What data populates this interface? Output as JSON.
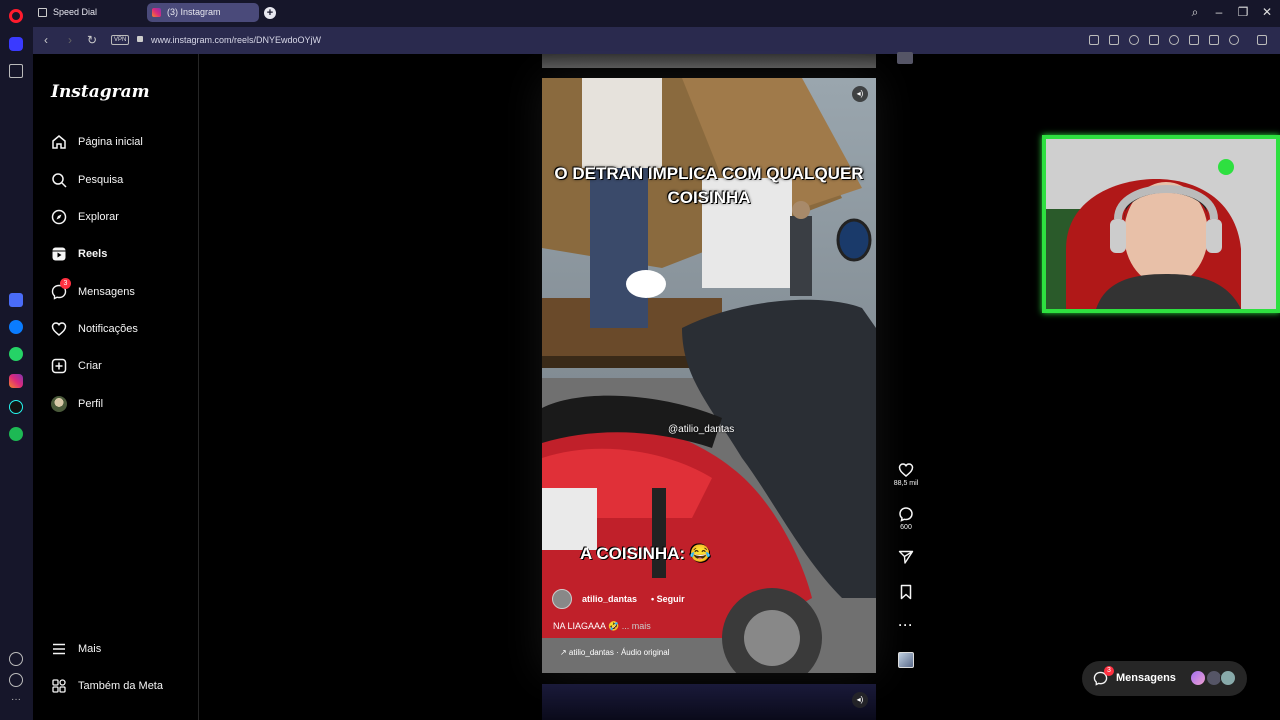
{
  "browser": {
    "tabs": [
      {
        "label": "Speed Dial"
      },
      {
        "label": "(3) Instagram"
      }
    ],
    "url": "www.instagram.com/reels/DNYEwdoOYjW",
    "vpn_label": "VPN"
  },
  "instagram": {
    "logo": "Instagram",
    "nav": [
      {
        "label": "Página inicial",
        "icon": "home-icon"
      },
      {
        "label": "Pesquisa",
        "icon": "search-icon"
      },
      {
        "label": "Explorar",
        "icon": "compass-icon"
      },
      {
        "label": "Reels",
        "icon": "reels-icon"
      },
      {
        "label": "Mensagens",
        "icon": "messenger-icon",
        "badge": "3"
      },
      {
        "label": "Notificações",
        "icon": "heart-icon"
      },
      {
        "label": "Criar",
        "icon": "plus-square-icon"
      },
      {
        "label": "Perfil",
        "icon": "profile-avatar"
      }
    ],
    "bottom_nav": [
      {
        "label": "Mais",
        "icon": "menu-icon"
      },
      {
        "label": "Também da Meta",
        "icon": "meta-grid-icon"
      }
    ]
  },
  "reel": {
    "caption_top": "O DETRAN IMPLICA COM QUALQUER COISINHA",
    "caption_bottom": "A COISINHA: 😂",
    "watermark": "@atilio_dantas",
    "username": "atilio_dantas",
    "follow": "• Seguir",
    "description": "NA LIAGAAA 🤣",
    "more": "... mais",
    "audio": "↗ atilio_dantas · Áudio original",
    "likes": "88,5 mil",
    "comments": "600"
  },
  "messages_pill": {
    "label": "Mensagens",
    "badge": "3"
  }
}
